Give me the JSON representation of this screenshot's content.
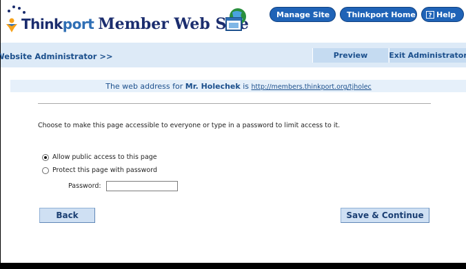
{
  "header": {
    "logo_think": "Think",
    "logo_port": "port",
    "logo_member": "Member Web Site",
    "buttons": {
      "manage_site": "Manage Site",
      "thinkport_home": "Thinkport Home",
      "help": "Help"
    }
  },
  "admin_bar": {
    "label": "Website Administrator >>",
    "tabs": {
      "preview": "Preview",
      "exit": "Exit Administrator"
    }
  },
  "address": {
    "prefix": "The web address for ",
    "name": "Mr. Holechek",
    "middle": " is ",
    "url": "http://members.thinkport.org/tjholec"
  },
  "main": {
    "instructions": "Choose to make this page accessible to everyone or type in a password to limit access to it.",
    "options": {
      "public": "Allow public access to this page",
      "protect": "Protect this page with password"
    },
    "selected_option": "public",
    "password_label": "Password:",
    "password_value": ""
  },
  "actions": {
    "back": "Back",
    "save_continue": "Save & Continue"
  },
  "colors": {
    "brand_dark": "#1b2d6e",
    "brand_light": "#2f6fb5",
    "admin_bar_bg": "#ddeaf7",
    "button_bg": "#1f63b7"
  },
  "icons": {
    "logo_figure": "thinkport-figure-icon",
    "globe": "globe-window-icon",
    "manage_site": "window-icon",
    "thinkport_home": "home-icon",
    "help": "question-icon"
  }
}
